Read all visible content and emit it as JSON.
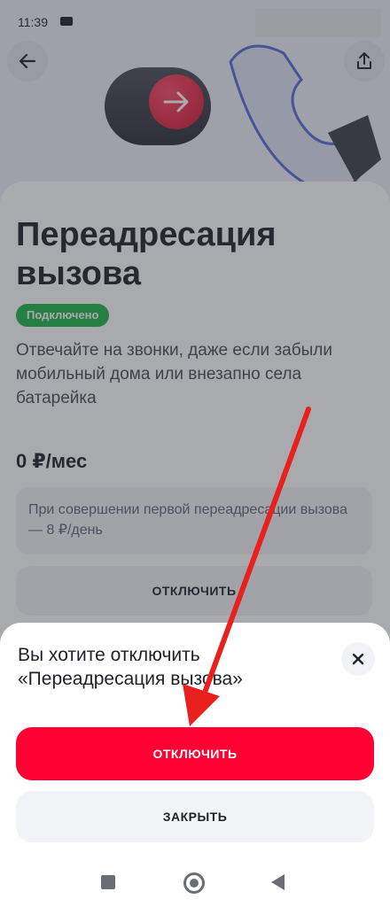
{
  "status_bar": {
    "time": "11:39"
  },
  "hero": {
    "back_icon": "arrow-left-icon",
    "share_icon": "share-icon"
  },
  "service": {
    "title": "Переадресация вызова",
    "status": "Подключено",
    "description": "Отвечайте на звонки, даже если забыли мобильный дома или внезапно села батарейка",
    "price": "0 ₽/мес",
    "price_note": "При совершении первой переадресации вызова — 8 ₽/день",
    "disable_label": "ОТКЛЮЧИТЬ"
  },
  "dialog": {
    "title": "Вы хотите отключить «Переадресация вызова»",
    "close_icon": "close-icon",
    "confirm_label": "ОТКЛЮЧИТЬ",
    "cancel_label": "ЗАКРЫТЬ"
  },
  "colors": {
    "accent_red": "#ff0032",
    "status_green": "#1db446",
    "annotation_red": "#e8201e"
  }
}
